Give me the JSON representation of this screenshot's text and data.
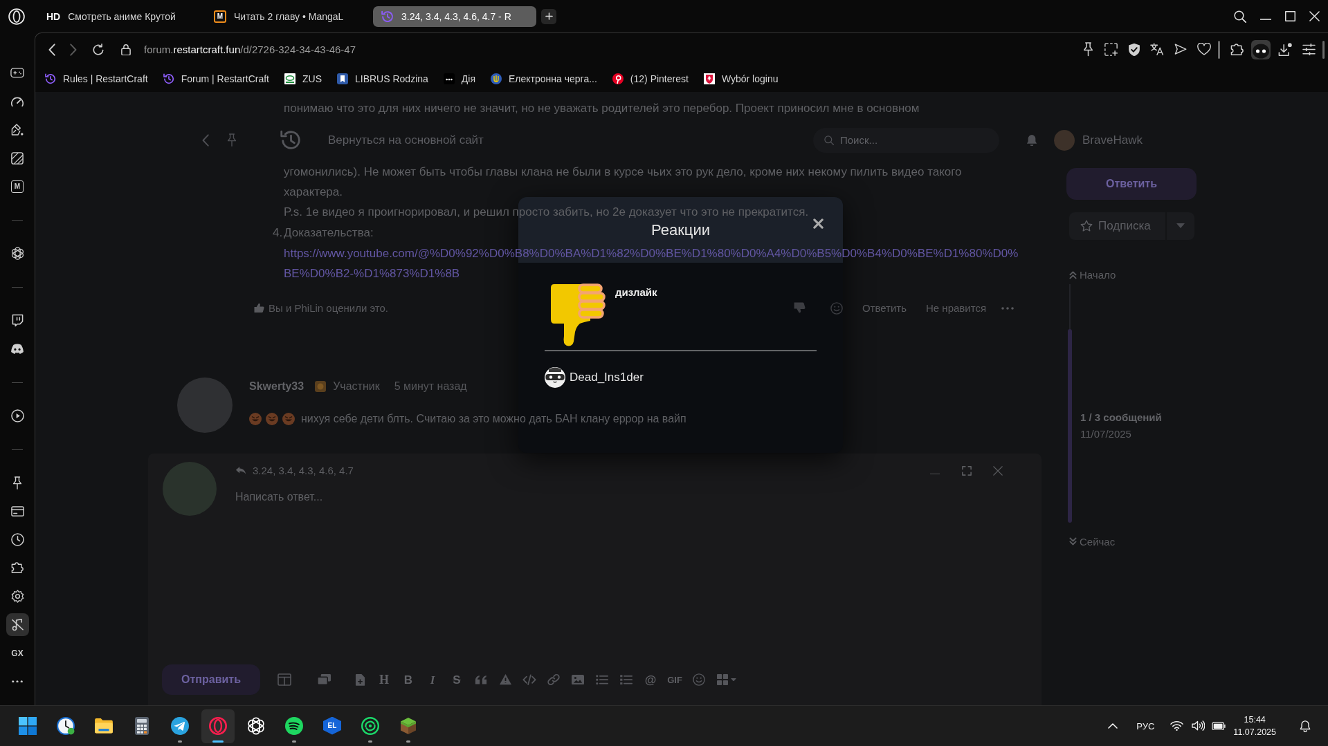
{
  "browser": {
    "tabs": [
      {
        "favicon": {
          "kind": "text",
          "text": "HD"
        },
        "title": "Смотреть аниме Крутой",
        "selected": false
      },
      {
        "favicon": {
          "kind": "tile",
          "text": "M"
        },
        "title": "Читать 2 главу • MangaL",
        "selected": false
      },
      {
        "favicon": {
          "kind": "logo"
        },
        "title": "3.24, 3.4, 4.3, 4.6, 4.7 - R",
        "selected": true
      }
    ],
    "address": {
      "subdomain": "forum.",
      "domain": "restartcraft.fun",
      "path": "/d/2726-324-34-43-46-47"
    },
    "bookmarks": [
      {
        "label": "Rules | RestartCraft"
      },
      {
        "label": "Forum | RestartCraft"
      },
      {
        "label": "ZUS"
      },
      {
        "label": "LIBRUS Rodzina"
      },
      {
        "label": "Дія"
      },
      {
        "label": "Електронна черга..."
      },
      {
        "label": "(12) Pinterest"
      },
      {
        "label": "Wybór loginu"
      }
    ],
    "sidebar": {
      "groups": [
        {
          "items": [
            {
              "kind": "icon",
              "selected": false
            },
            {
              "kind": "icon",
              "selected": false
            },
            {
              "kind": "icon",
              "selected": false
            },
            {
              "kind": "icon",
              "selected": false
            },
            {
              "kind": "tile",
              "label": "M",
              "selected": false
            }
          ]
        },
        {
          "items": [
            {
              "kind": "icon",
              "selected": false
            }
          ]
        },
        {
          "items": [
            {
              "kind": "icon",
              "selected": false
            },
            {
              "kind": "icon",
              "selected": false
            }
          ]
        },
        {
          "items": [
            {
              "kind": "icon",
              "selected": false
            }
          ]
        },
        {
          "items": [
            {
              "kind": "icon",
              "selected": false
            },
            {
              "kind": "icon",
              "selected": false
            },
            {
              "kind": "icon",
              "selected": false
            },
            {
              "kind": "icon",
              "selected": false
            },
            {
              "kind": "icon",
              "selected": false
            },
            {
              "kind": "icon",
              "selected": true
            },
            {
              "kind": "text",
              "label": "GX",
              "selected": false
            },
            {
              "kind": "icon",
              "selected": false
            }
          ]
        }
      ]
    }
  },
  "forum": {
    "header": {
      "link": "Вернуться на основной сайт",
      "search_placeholder": "Поиск...",
      "user": "BraveHawk"
    },
    "post": {
      "cut_line": "понимаю что это для них ничего не значит, но не уважать родителей это перебор. Проект приносил мне в основном",
      "paragraphs": [
        {
          "lines": [
            "угомонились). Не может быть чтобы главы клана не были в курсе чьих это рук дело, кроме них некому пилить видео такого",
            "характера."
          ]
        },
        {
          "lines": [
            "P.s. 1е видео я проигнорировал, и решил просто забить, но 2е доказует что это не прекратится."
          ]
        }
      ],
      "list_item": {
        "number": "4.",
        "label": "Доказательства:",
        "link_lines": [
          "https://www.youtube.com/@%D0%92%D0%B8%D0%BA%D1%82%D0%BE%D1%80%D0%A4%D0%B5%D0%B4%D0%BE%D1%80%D0%",
          "BE%D0%B2-%D1%873%D1%8B"
        ]
      },
      "likes": "Вы и PhiLin оценили это.",
      "actions": [
        "Ответить",
        "Не нравится"
      ]
    },
    "reply": {
      "author": "Skwerty33",
      "role": "Участник",
      "time": "5 минут назад",
      "emojis": [
        {
          "kind": "rofl"
        },
        {
          "kind": "rofl"
        },
        {
          "kind": "rofl"
        }
      ],
      "text": "нихуя себе дети блть. Считаю за это можно дать БАН клану еррор на вайп"
    },
    "composer": {
      "title": "3.24, 3.4, 4.3, 4.6, 4.7",
      "placeholder": "Написать ответ...",
      "submit": "Отправить",
      "tools": [
        {
          "kind": "columns"
        },
        {
          "kind": "gallery"
        },
        {
          "kind": "file"
        },
        {
          "kind": "heading",
          "label": "H"
        },
        {
          "kind": "bold",
          "label": "B"
        },
        {
          "kind": "italic",
          "label": "I"
        },
        {
          "kind": "strike",
          "label": "S"
        },
        {
          "kind": "quote"
        },
        {
          "kind": "spoiler"
        },
        {
          "kind": "code"
        },
        {
          "kind": "link"
        },
        {
          "kind": "image"
        },
        {
          "kind": "bullets"
        },
        {
          "kind": "numbers"
        },
        {
          "kind": "mention",
          "label": "@"
        },
        {
          "kind": "gif",
          "label": "GIF"
        },
        {
          "kind": "emoji"
        },
        {
          "kind": "widgets"
        }
      ]
    },
    "aside": {
      "reply": "Ответить",
      "follow": "Подписка",
      "start": "Начало",
      "position": "1 / 3 сообщений",
      "date": "11/07/2025",
      "end": "Сейчас"
    }
  },
  "modal": {
    "title": "Реакции",
    "reaction": "дизлайк",
    "users": [
      {
        "name": "Dead_Ins1der"
      }
    ]
  },
  "taskbar": {
    "apps": [
      {
        "selected": false,
        "running": false
      },
      {
        "selected": false,
        "running": false
      },
      {
        "selected": false,
        "running": false
      },
      {
        "selected": false,
        "running": false
      },
      {
        "selected": false,
        "running": true
      },
      {
        "selected": true,
        "running": true
      },
      {
        "selected": false,
        "running": false
      },
      {
        "selected": false,
        "running": true
      },
      {
        "label": "EL",
        "selected": false,
        "running": false
      },
      {
        "selected": false,
        "running": true
      },
      {
        "selected": false,
        "running": true
      }
    ],
    "tray": {
      "language": "РУС",
      "time": "15:44",
      "date": "11.07.2025"
    }
  }
}
